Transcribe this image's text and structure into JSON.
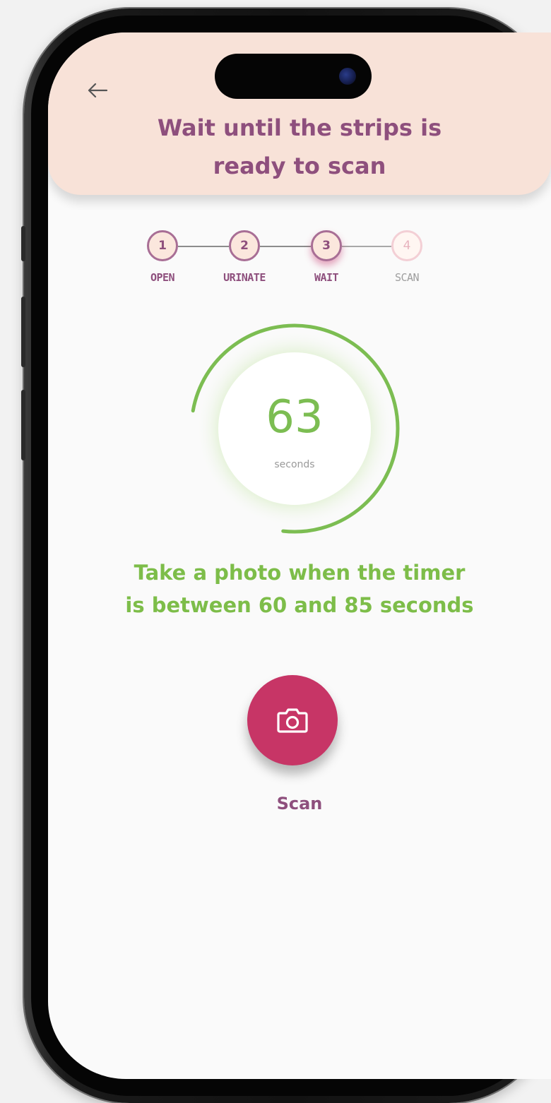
{
  "header": {
    "title_line1": "Wait until the strips is",
    "title_line2": "ready to scan",
    "back_icon": "arrow-left-icon",
    "background": "#f8e2d8",
    "title_color": "#8e4f7d"
  },
  "stepper": {
    "steps": [
      {
        "number": "1",
        "label": "OPEN",
        "state": "done"
      },
      {
        "number": "2",
        "label": "URINATE",
        "state": "done"
      },
      {
        "number": "3",
        "label": "WAIT",
        "state": "active"
      },
      {
        "number": "4",
        "label": "SCAN",
        "state": "pending"
      }
    ]
  },
  "timer": {
    "value": "63",
    "unit": "seconds",
    "progress": 0.74,
    "color": "#7cbd52"
  },
  "instruction": {
    "line1": "Take a photo when the timer",
    "line2": "is between 60 and 85 seconds",
    "color": "#7dbd49"
  },
  "scan": {
    "label": "Scan",
    "icon": "camera-icon",
    "color": "#c73566"
  }
}
